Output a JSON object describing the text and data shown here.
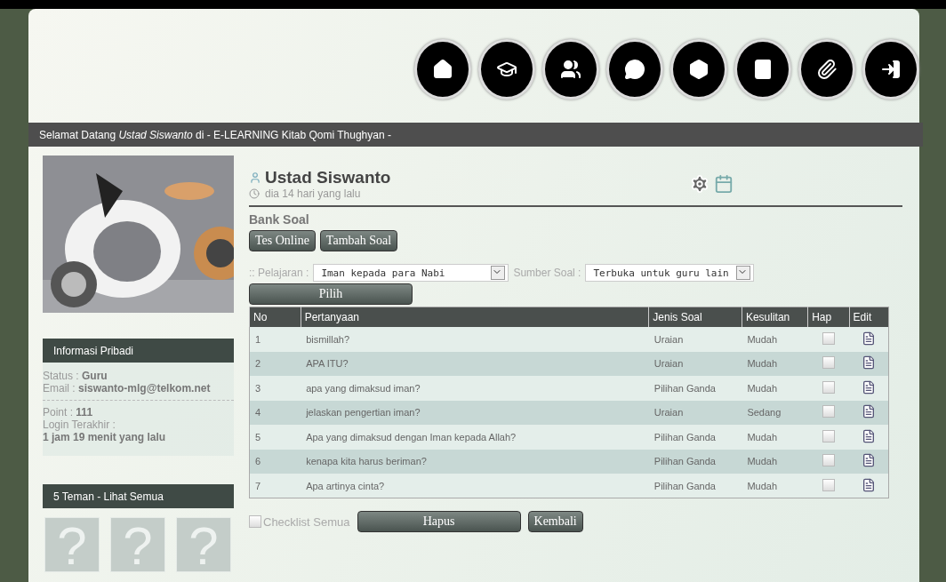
{
  "welcome_bar": "Selamat Datang *Ustad Siswanto* di - E-LEARNING Kitab Qomi Thughyan -",
  "sidebar": {
    "info": {
      "title": "Informasi Pribadi",
      "lines_top": [
        "Status : **Guru**",
        "Email : **siswanto-mlg@telkom.net**"
      ],
      "lines_bottom": [
        "Point : **111**",
        "Login Terakhir :",
        "**1 jam 19 menit yang lalu**"
      ]
    },
    "friends": {
      "title": "5 Teman - Lihat Semua",
      "avatars": [
        "?",
        "?",
        "?"
      ]
    }
  },
  "profile": {
    "name": "Ustad Siswanto",
    "last_seen": "dia 14 hari yang lalu"
  },
  "section_title": "Bank Soal",
  "tab_buttons": [
    "Tes Online",
    "Tambah Soal"
  ],
  "filters": [
    {
      "label": ":: Pelajaran :",
      "value": "Iman kepada para Nabi"
    },
    {
      "label": "Sumber Soal :",
      "value": "Terbuka untuk guru lain"
    }
  ],
  "submit_button": "Pilih",
  "table": {
    "columns": [
      "No",
      "Pertanyaan",
      "Jenis Soal",
      "Kesulitan",
      "Hap",
      "Edit"
    ],
    "rows": [
      {
        "no": "1",
        "question": "bismillah?",
        "type": "Uraian",
        "difficulty": "Mudah",
        "checked": false
      },
      {
        "no": "2",
        "question": "APA ITU?",
        "type": "Uraian",
        "difficulty": "Mudah",
        "checked": false
      },
      {
        "no": "3",
        "question": "apa yang dimaksud iman?",
        "type": "Pilihan Ganda",
        "difficulty": "Mudah",
        "checked": false
      },
      {
        "no": "4",
        "question": "jelaskan pengertian iman?",
        "type": "Uraian",
        "difficulty": "Sedang",
        "checked": false
      },
      {
        "no": "5",
        "question": "Apa yang dimaksud dengan Iman kepada Allah?",
        "type": "Pilihan Ganda",
        "difficulty": "Mudah",
        "checked": false
      },
      {
        "no": "6",
        "question": "kenapa kita harus beriman?",
        "type": "Pilihan Ganda",
        "difficulty": "Mudah",
        "checked": false
      },
      {
        "no": "7",
        "question": "Apa artinya cinta?",
        "type": "Pilihan Ganda",
        "difficulty": "Mudah",
        "checked": false
      }
    ]
  },
  "select_all": {
    "label": "Checklist Semua",
    "checked": false
  },
  "footer_buttons": [
    "Hapus",
    "Kembali"
  ]
}
